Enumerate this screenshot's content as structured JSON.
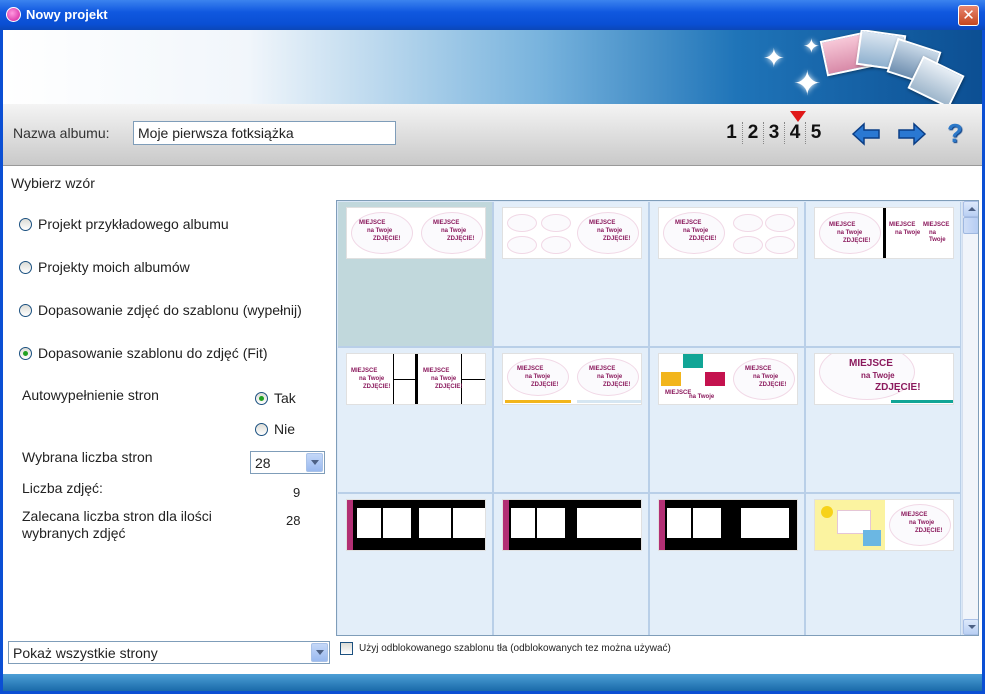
{
  "window": {
    "title": "Nowy projekt",
    "close_label": "✕"
  },
  "toolbar": {
    "album_label": "Nazwa albumu:",
    "album_value": "Moje pierwsza fotksiążka",
    "steps": [
      "1",
      "2",
      "3",
      "4",
      "5"
    ],
    "current_step": "4",
    "help_label": "?"
  },
  "main": {
    "section_title": "Wybierz wzór",
    "options": [
      {
        "label": "Projekt przykładowego albumu",
        "selected": false
      },
      {
        "label": "Projekty moich albumów",
        "selected": false
      },
      {
        "label": "Dopasowanie zdjęć do szablonu (wypełnij)",
        "selected": false
      },
      {
        "label": "Dopasowanie szablonu do zdjęć (Fit)",
        "selected": true
      }
    ],
    "autofill_label": "Autowypełnienie stron",
    "autofill_yes": "Tak",
    "autofill_no": "Nie",
    "pages_label": "Wybrana liczba stron",
    "pages_value": "28",
    "photos_label": "Liczba zdjęć:",
    "photos_value": "9",
    "recommended_label": "Zalecana liczba stron dla ilości wybranych zdjęć",
    "recommended_value": "28",
    "show_select": "Pokaż wszystkie strony",
    "unlock_checkbox": "Użyj odblokowanego szablonu tła (odblokowanych tez można używać)"
  },
  "thumbs": {
    "miejsce": "MIEJSCE",
    "na_twoje": "na Twoje",
    "zdjecie": "ZDJĘCIE!"
  },
  "colors": {
    "accent_pink": "#8b1a5d",
    "title_blue": "#0a4fd4",
    "banner_blue": "#1f74b8"
  },
  "icons": [
    "app-icon",
    "close-icon",
    "back-arrow-icon",
    "forward-arrow-icon",
    "help-icon"
  ]
}
